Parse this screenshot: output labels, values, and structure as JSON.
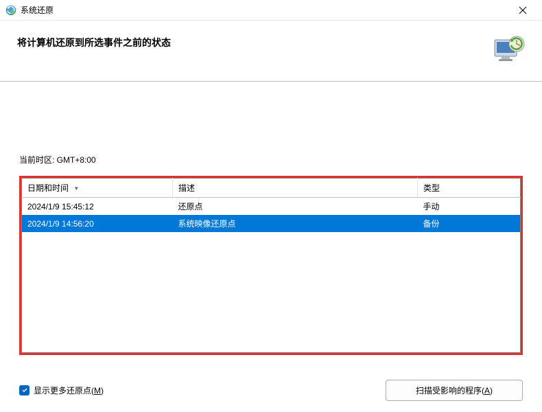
{
  "titlebar": {
    "title": "系统还原"
  },
  "header": {
    "text": "将计算机还原到所选事件之前的状态"
  },
  "timezone": {
    "label": "当前时区: GMT+8:00"
  },
  "table": {
    "headers": {
      "date": "日期和时间",
      "desc": "描述",
      "type": "类型"
    },
    "rows": [
      {
        "date": "2024/1/9 15:45:12",
        "desc": "还原点",
        "type": "手动",
        "selected": false
      },
      {
        "date": "2024/1/9 14:56:20",
        "desc": "系统映像还原点",
        "type": "备份",
        "selected": true
      }
    ]
  },
  "footer": {
    "checkbox_label_pre": "显示更多还原点(",
    "checkbox_label_key": "M",
    "checkbox_label_post": ")",
    "scan_pre": "扫描受影响的程序(",
    "scan_key": "A",
    "scan_post": ")"
  }
}
